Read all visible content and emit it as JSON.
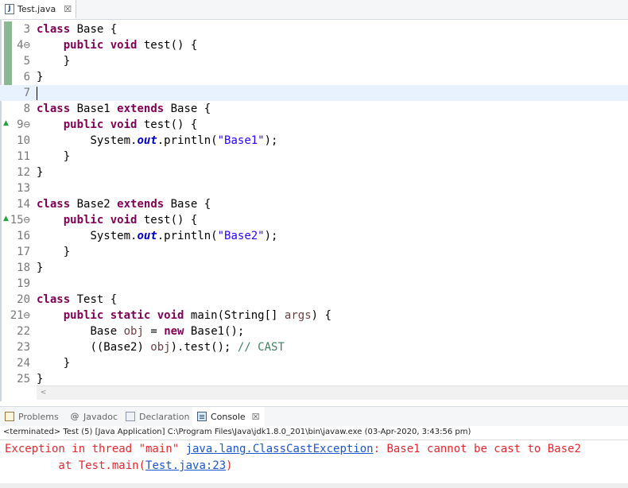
{
  "editor_tab": {
    "filename": "Test.java",
    "icon": "java-file-icon",
    "close": "☒"
  },
  "code_lines": [
    {
      "num": "3"
    },
    {
      "num": "4⊖"
    },
    {
      "num": "5"
    },
    {
      "num": "6"
    },
    {
      "num": "7"
    },
    {
      "num": "8"
    },
    {
      "num": "9⊖"
    },
    {
      "num": "10"
    },
    {
      "num": "11"
    },
    {
      "num": "12"
    },
    {
      "num": "13"
    },
    {
      "num": "14"
    },
    {
      "num": "15⊖"
    },
    {
      "num": "16"
    },
    {
      "num": "17"
    },
    {
      "num": "18"
    },
    {
      "num": "19"
    },
    {
      "num": "20"
    },
    {
      "num": "21⊖"
    },
    {
      "num": "22"
    },
    {
      "num": "23"
    },
    {
      "num": "24"
    },
    {
      "num": "25"
    }
  ],
  "code": {
    "l3": {
      "kw": "class",
      "rest": " Base {"
    },
    "l4": {
      "kw1": "public",
      "kw2": "void",
      "rest": " test() {"
    },
    "l5": {
      "text": "}"
    },
    "l6": {
      "text": "}"
    },
    "l8": {
      "kw1": "class",
      "mid": " Base1 ",
      "kw2": "extends",
      "rest": " Base {"
    },
    "l9": {
      "kw1": "public",
      "kw2": "void",
      "rest": " test() {"
    },
    "l10": {
      "pre": "System.",
      "field": "out",
      "mid": ".println(",
      "str": "\"Base1\"",
      "post": ");"
    },
    "l11": {
      "text": "}"
    },
    "l12": {
      "text": "}"
    },
    "l14": {
      "kw1": "class",
      "mid": " Base2 ",
      "kw2": "extends",
      "rest": " Base {"
    },
    "l15": {
      "kw1": "public",
      "kw2": "void",
      "rest": " test() {"
    },
    "l16": {
      "pre": "System.",
      "field": "out",
      "mid": ".println(",
      "str": "\"Base2\"",
      "post": ");"
    },
    "l17": {
      "text": "}"
    },
    "l18": {
      "text": "}"
    },
    "l20": {
      "kw": "class",
      "rest": " Test {"
    },
    "l21": {
      "kw1": "public",
      "kw2": "static",
      "kw3": "void",
      "mid": " main(String[] ",
      "var": "args",
      "post": ") {"
    },
    "l22": {
      "pre": "Base ",
      "var": "obj",
      "mid": " = ",
      "kw": "new",
      "post": " Base1();"
    },
    "l23": {
      "pre": "((Base2) ",
      "var": "obj",
      "mid": ").test(); ",
      "cmt": "// CAST"
    },
    "l24": {
      "text": "}"
    },
    "l25": {
      "text": "}"
    }
  },
  "scroll_left_arrow": "<",
  "view_tabs": [
    {
      "label": "Problems",
      "icon": "problems-icon"
    },
    {
      "label": "Javadoc",
      "icon": "javadoc-icon"
    },
    {
      "label": "Declaration",
      "icon": "declaration-icon"
    },
    {
      "label": "Console",
      "icon": "console-icon",
      "active": true,
      "close": "☒"
    }
  ],
  "console": {
    "status": "<terminated> Test (5) [Java Application] C:\\Program Files\\Java\\jdk1.8.0_201\\bin\\javaw.exe (03-Apr-2020, 3:43:56 pm)",
    "line1_pre": "Exception in thread \"main\" ",
    "line1_link": "java.lang.ClassCastException",
    "line1_post": ": Base1 cannot be cast to Base2",
    "line2_pre": "        at Test.main(",
    "line2_link": "Test.java:23",
    "line2_post": ")"
  },
  "colors": {
    "keyword": "#7f0055",
    "string": "#2a00ff",
    "comment": "#3f7f5f",
    "error": "#e0282e",
    "link": "#1a57c9"
  }
}
